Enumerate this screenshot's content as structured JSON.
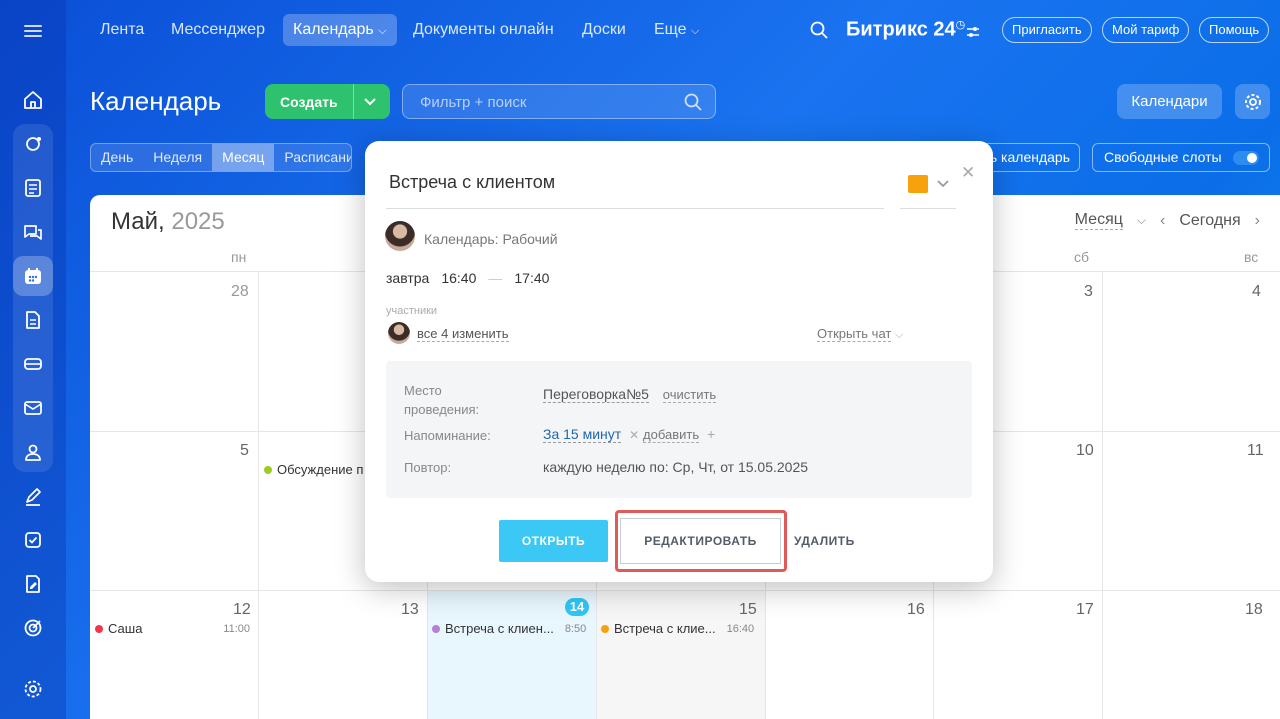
{
  "topnav": {
    "items": [
      "Лента",
      "Мессенджер",
      "Календарь",
      "Документы онлайн",
      "Доски",
      "Еще"
    ],
    "active": "Календарь",
    "brand": "Битрикс 24",
    "invite": "Пригласить",
    "tariff": "Мой тариф",
    "help": "Помощь"
  },
  "header": {
    "title": "Календарь",
    "create": "Создать",
    "search_placeholder": "Фильтр + поиск",
    "calendars": "Календари"
  },
  "view_tabs": [
    "День",
    "Неделя",
    "Месяц",
    "Расписание"
  ],
  "active_view": "Месяц",
  "share_label": "ь календарь",
  "free_slots": "Свободные слоты",
  "calendar": {
    "month": "Май,",
    "year": "2025",
    "view_select": "Месяц",
    "today": "Сегодня",
    "dow": [
      "пн",
      "сб",
      "вс"
    ],
    "days": {
      "d28": "28",
      "d3": "3",
      "d4": "4",
      "d5": "5",
      "d10": "10",
      "d11": "11",
      "d12": "12",
      "d13": "13",
      "d14": "14",
      "d15": "15",
      "d16": "16",
      "d17": "17",
      "d18": "18"
    },
    "events": [
      {
        "title": "Обсуждение п",
        "time": "",
        "color": "#9bcc1f"
      },
      {
        "title": "Саша",
        "time": "11:00",
        "color": "#f0374c"
      },
      {
        "title": "Встреча с клиен...",
        "time": "8:50",
        "color": "#b77ed6"
      },
      {
        "title": "Встреча с клие...",
        "time": "16:40",
        "color": "#f7a20c"
      }
    ]
  },
  "popup": {
    "title": "Встреча с клиентом",
    "color": "#f7a20c",
    "calendar": "Календарь: Рабочий",
    "day": "завтра",
    "start": "16:40",
    "end": "17:40",
    "participants_label": "участники",
    "participants": "все 4 изменить",
    "open_chat": "Открыть чат",
    "place_label": "Место проведения:",
    "place": "Переговорка№5",
    "clear": "очистить",
    "reminder_label": "Напоминание:",
    "reminder": "За 15 минут",
    "add": "добавить",
    "repeat_label": "Повтор:",
    "repeat": "каждую неделю по: Ср, Чт, от 15.05.2025",
    "btn_open": "ОТКРЫТЬ",
    "btn_edit": "РЕДАКТИРОВАТЬ",
    "btn_delete": "УДАЛИТЬ"
  }
}
